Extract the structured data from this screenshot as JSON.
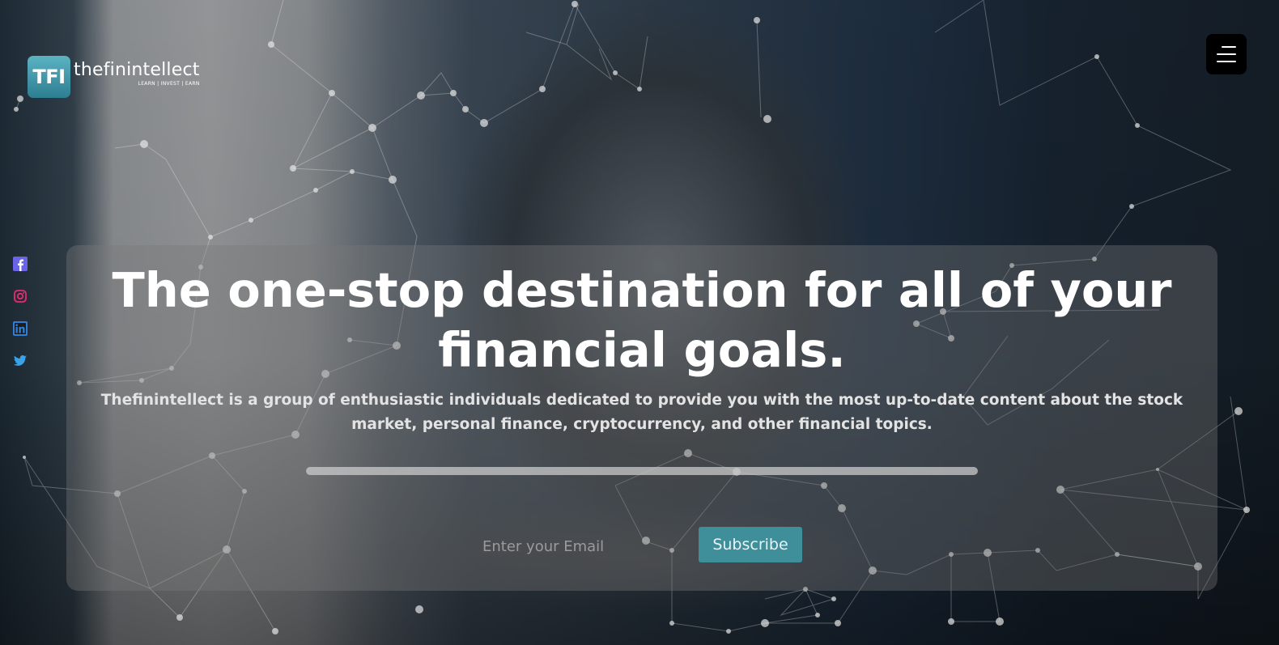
{
  "logo": {
    "badge": "TFI",
    "name": "thefinintellect",
    "tagline": "LEARN | INVEST | EARN"
  },
  "menu": {
    "icon": "hamburger-menu-icon"
  },
  "social": [
    {
      "name": "facebook-icon",
      "color": "#6a64e8"
    },
    {
      "name": "instagram-icon",
      "color": "#e0306e"
    },
    {
      "name": "linkedin-icon",
      "color": "#2f7fd8"
    },
    {
      "name": "twitter-icon",
      "color": "#3aa3e8"
    }
  ],
  "hero": {
    "title": "The one-stop destination for all of your financial goals.",
    "description": "Thefinintellect is a group of enthusiastic individuals dedicated to provide you with the most up-to-date content about the stock market, personal finance, cryptocurrency, and other financial topics."
  },
  "progress": {
    "value": 1.0
  },
  "subscribe": {
    "email_placeholder": "Enter your Email",
    "button_label": "Subscribe"
  },
  "colors": {
    "accent": "#3f8f9b",
    "logo_badge": "#4aa0b2",
    "panel": "rgba(120,120,120,0.38)"
  }
}
